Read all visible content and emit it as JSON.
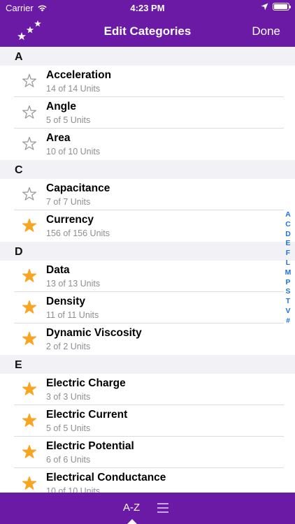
{
  "status_bar": {
    "carrier": "Carrier",
    "time": "4:23 PM",
    "battery": 0.95
  },
  "nav": {
    "title": "Edit Categories",
    "done": "Done",
    "logo_icon": "three-stars-icon"
  },
  "sections": [
    {
      "letter": "A",
      "items": [
        {
          "name": "Acceleration",
          "units": "14 of 14 Units",
          "starred": false
        },
        {
          "name": "Angle",
          "units": "5 of 5 Units",
          "starred": false
        },
        {
          "name": "Area",
          "units": "10 of 10 Units",
          "starred": false
        }
      ]
    },
    {
      "letter": "C",
      "items": [
        {
          "name": "Capacitance",
          "units": "7 of 7 Units",
          "starred": false
        },
        {
          "name": "Currency",
          "units": "156 of 156 Units",
          "starred": true
        }
      ]
    },
    {
      "letter": "D",
      "items": [
        {
          "name": "Data",
          "units": "13 of 13 Units",
          "starred": true
        },
        {
          "name": "Density",
          "units": "11 of 11 Units",
          "starred": true
        },
        {
          "name": "Dynamic Viscosity",
          "units": "2 of 2 Units",
          "starred": true
        }
      ]
    },
    {
      "letter": "E",
      "items": [
        {
          "name": "Electric Charge",
          "units": "3 of 3 Units",
          "starred": true
        },
        {
          "name": "Electric Current",
          "units": "5 of 5 Units",
          "starred": true
        },
        {
          "name": "Electric Potential",
          "units": "6 of 6 Units",
          "starred": true
        },
        {
          "name": "Electrical Conductance",
          "units": "10 of 10 Units",
          "starred": true
        }
      ]
    }
  ],
  "index": [
    "A",
    "C",
    "D",
    "E",
    "F",
    "L",
    "M",
    "P",
    "S",
    "T",
    "V",
    "#"
  ],
  "tab_bar": {
    "az_label": "A-Z",
    "list_icon": "list-icon"
  },
  "colors": {
    "accent": "#6a1aa5",
    "star_filled": "#f6a623",
    "star_outline": "#9b9b9b",
    "index": "#1a73e8"
  }
}
